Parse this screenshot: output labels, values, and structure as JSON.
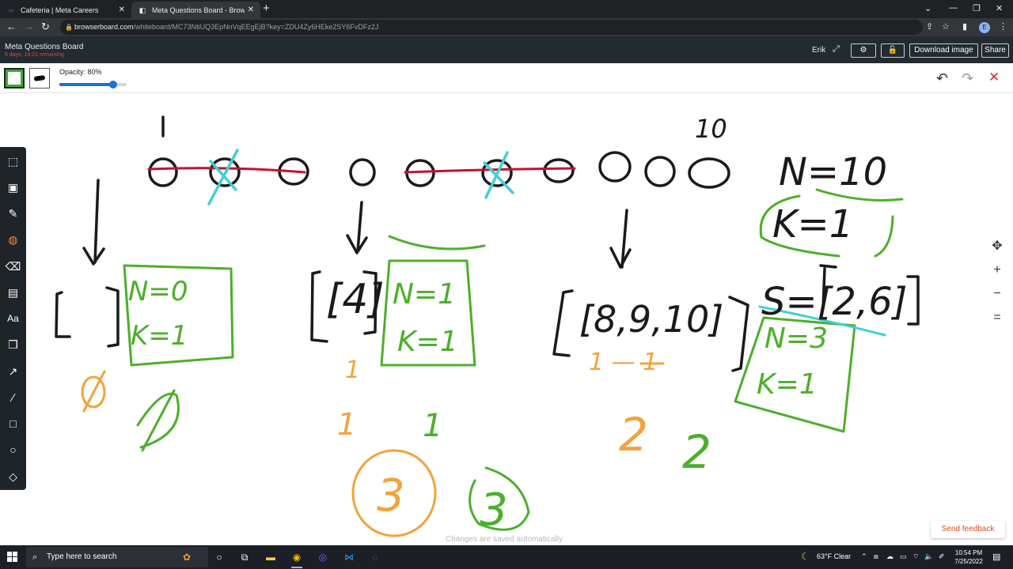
{
  "browser": {
    "tabs": [
      {
        "title": "Cafeteria | Meta Careers",
        "icon": "meta-icon",
        "active": false
      },
      {
        "title": "Meta Questions Board - Browser",
        "icon": "browserboard-icon",
        "active": true
      }
    ],
    "url_host": "browserboard.com",
    "url_path": "/whiteboard/MC73NtiUQ3EpNnVqEEgEjB?key=ZDU4Zy6HEke2SY6FvDFz2J",
    "profile_initial": "E"
  },
  "board": {
    "title": "Meta Questions Board",
    "subtitle": "6 days, 18:21 remaining",
    "user": "Erik",
    "download_label": "Download image",
    "share_label": "Share"
  },
  "options": {
    "opacity_label": "Opacity: 80%",
    "opacity_value": 0.8,
    "color": "#3aaa3a"
  },
  "tools": [
    "select-icon",
    "image-icon",
    "brush-icon",
    "highlighter-icon",
    "eraser-icon",
    "sticky-note-icon",
    "text-icon",
    "book-icon",
    "arrow-icon",
    "line-icon",
    "square-icon",
    "circle-icon",
    "diamond-icon"
  ],
  "canvas_text": {
    "index_one": "1",
    "index_ten": "10",
    "n_total": "N=10",
    "k_total": "K=1",
    "s_list": "S=[2,6]",
    "empty_bracket": "[ ]",
    "box1_n": "N=0",
    "box1_k": "K=1",
    "empty_set_orange": "Ø",
    "empty_set_green": "Ø",
    "bracket_four": "[4]",
    "box2_n": "N=1",
    "box2_k": "K=1",
    "orange_one_small": "1",
    "orange_one": "1",
    "green_one": "1",
    "circled_three_orange": "3",
    "circled_three_green": "3",
    "bracket_list": "[8,9,10]",
    "orange_marks": "1 — 1",
    "box3_n": "N=3",
    "box3_k": "K=1",
    "orange_two": "2",
    "green_two": "2"
  },
  "feedback_label": "Send feedback",
  "saved_message": "Changes are saved automatically",
  "taskbar": {
    "search_placeholder": "Type here to search",
    "weather": "63°F  Clear",
    "time": "10:54 PM",
    "date": "7/25/2022"
  },
  "colors": {
    "ink_black": "#1a1a1a",
    "ink_red": "#c8102e",
    "ink_cyan": "#3fd0d6",
    "ink_green": "#4caf2a",
    "ink_orange": "#f4a23a"
  }
}
